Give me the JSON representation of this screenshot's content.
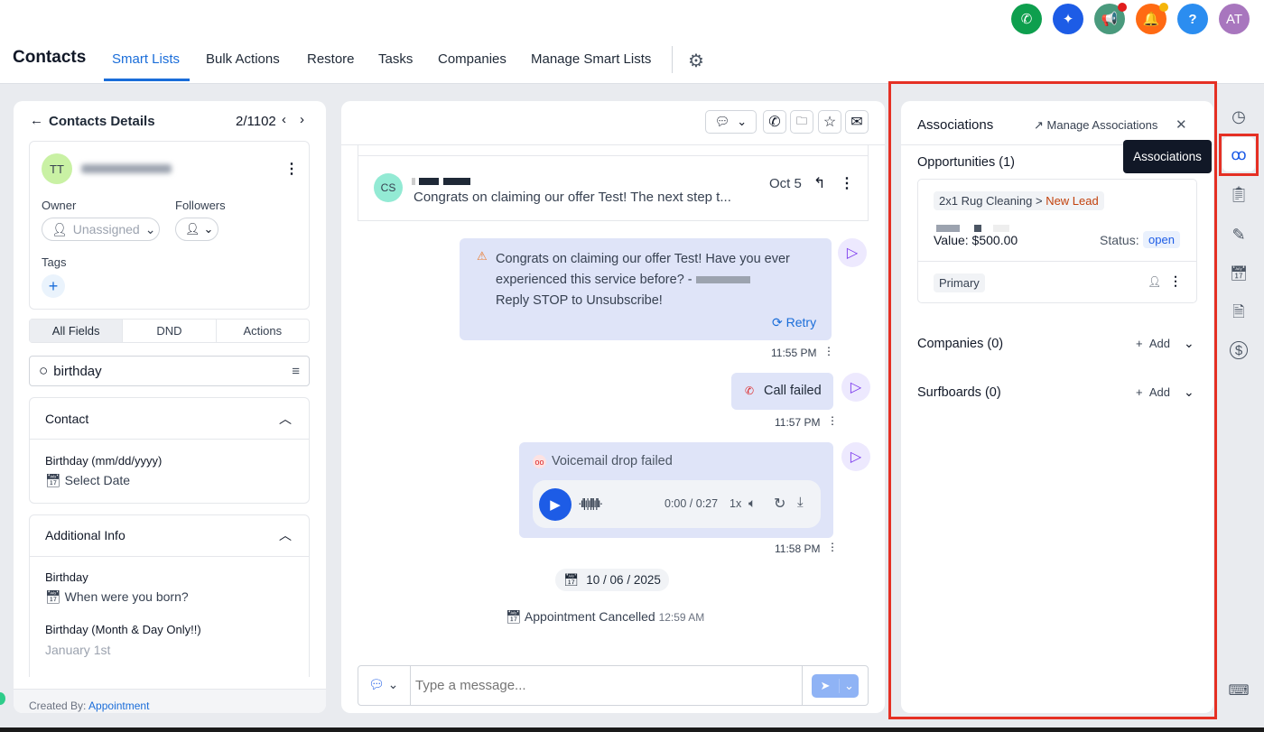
{
  "header": {
    "title": "Contacts",
    "tabs": [
      "Smart Lists",
      "Bulk Actions",
      "Restore",
      "Tasks",
      "Companies",
      "Manage Smart Lists"
    ],
    "active_tab": "Smart Lists",
    "avatar_initials": "AT",
    "help": "?"
  },
  "colors": {
    "accent": "#1a6dd9",
    "phone": "#0e9f4e",
    "ai": "#1d5ce6",
    "announce": "#4a9a7d",
    "bell": "#ff6a13",
    "help": "#2b8df0",
    "avatar": "#a876be",
    "highlight": "#e53024"
  },
  "contact": {
    "back_label": "Contacts Details",
    "position": "2/1102",
    "initials": "TT",
    "owner_label": "Owner",
    "owner_value": "Unassigned",
    "followers_label": "Followers",
    "tags_label": "Tags",
    "tabs": [
      "All Fields",
      "DND",
      "Actions"
    ],
    "search_value": "birthday",
    "sections": [
      {
        "title": "Contact",
        "fields": [
          {
            "label": "Birthday (mm/dd/yyyy)",
            "value": "Select Date"
          }
        ]
      },
      {
        "title": "Additional Info",
        "fields": [
          {
            "label": "Birthday",
            "value": "When were you born?"
          },
          {
            "label": "Birthday (Month & Day Only!!)",
            "value": "January 1st"
          }
        ]
      }
    ],
    "created_by_label": "Created By:",
    "created_by_value": "Appointment"
  },
  "conversation": {
    "thread": {
      "initials": "CS",
      "preview": "Congrats on claiming our offer Test! The next step t...",
      "date": "Oct 5"
    },
    "messages": [
      {
        "text": "Congrats on claiming our offer Test! Have you ever experienced this service before? -",
        "text2": "Reply STOP to Unsubscribe!",
        "retry": "Retry",
        "time": "11:55 PM"
      },
      {
        "text": "Call failed",
        "time": "11:57 PM"
      },
      {
        "text": "Voicemail drop failed",
        "audio_time": "0:00 / 0:27",
        "speed": "1x",
        "time": "11:58 PM"
      }
    ],
    "date_divider": "10 / 06 / 2025",
    "event": "Appointment Cancelled",
    "event_time": "12:59 AM",
    "composer_placeholder": "Type a message..."
  },
  "associations": {
    "title": "Associations",
    "manage": "Manage Associations",
    "opportunities_label": "Opportunities (1)",
    "pipeline": "2x1 Rug Cleaning",
    "stage": "New Lead",
    "value": "Value: $500.00",
    "status_label": "Status:",
    "status": "open",
    "primary": "Primary",
    "companies_label": "Companies (0)",
    "surfboards_label": "Surfboards (0)",
    "add": "Add",
    "tooltip": "Associations"
  }
}
